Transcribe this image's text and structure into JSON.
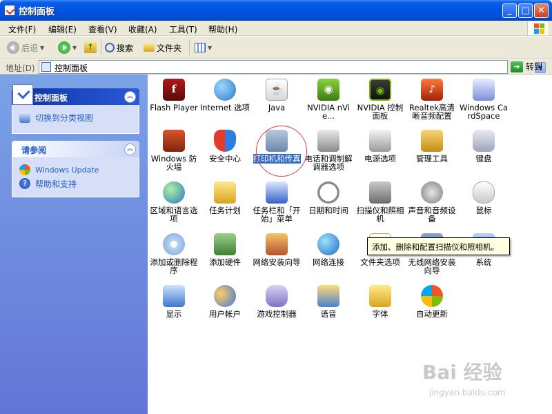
{
  "window": {
    "title": "控制面板"
  },
  "menu": [
    "文件(F)",
    "编辑(E)",
    "查看(V)",
    "收藏(A)",
    "工具(T)",
    "帮助(H)"
  ],
  "toolbar": {
    "back": "后退",
    "search": "搜索",
    "folders": "文件夹"
  },
  "address": {
    "label": "地址(D)",
    "value": "控制面板",
    "go": "转到"
  },
  "sidebar": {
    "cp_panel_title": "控制面板",
    "switch_view": "切换到分类视图",
    "see_also_title": "请参阅",
    "windows_update": "Windows Update",
    "help_support": "帮助和支持"
  },
  "items": [
    {
      "label": "Flash Player",
      "icon": "flash-icon"
    },
    {
      "label": "Internet 选项",
      "icon": "internet-options-icon"
    },
    {
      "label": "Java",
      "icon": "java-icon"
    },
    {
      "label": "NVIDIA nVie...",
      "icon": "nvidia-nview-icon"
    },
    {
      "label": "NVIDIA 控制面板",
      "icon": "nvidia-control-panel-icon"
    },
    {
      "label": "Realtek高清晰音频配置",
      "icon": "realtek-audio-icon"
    },
    {
      "label": "Windows CardSpace",
      "icon": "cardspace-icon"
    },
    {
      "label": "Windows 防火墙",
      "icon": "firewall-icon"
    },
    {
      "label": "安全中心",
      "icon": "security-center-icon"
    },
    {
      "label": "打印机和传真",
      "icon": "printer-fax-icon"
    },
    {
      "label": "电话和调制解调器选项",
      "icon": "phone-modem-icon"
    },
    {
      "label": "电源选项",
      "icon": "power-options-icon"
    },
    {
      "label": "管理工具",
      "icon": "admin-tools-icon"
    },
    {
      "label": "键盘",
      "icon": "keyboard-icon"
    },
    {
      "label": "区域和语言选项",
      "icon": "region-language-icon"
    },
    {
      "label": "任务计划",
      "icon": "scheduled-tasks-icon"
    },
    {
      "label": "任务栏和「开始」菜单",
      "icon": "taskbar-start-icon"
    },
    {
      "label": "日期和时间",
      "icon": "date-time-icon"
    },
    {
      "label": "扫描仪和照相机",
      "icon": "scanner-camera-icon"
    },
    {
      "label": "声音和音频设备",
      "icon": "sound-audio-icon"
    },
    {
      "label": "鼠标",
      "icon": "mouse-icon"
    },
    {
      "label": "添加或删除程序",
      "icon": "add-remove-programs-icon"
    },
    {
      "label": "添加硬件",
      "icon": "add-hardware-icon"
    },
    {
      "label": "网络安装向导",
      "icon": "network-setup-icon"
    },
    {
      "label": "网络连接",
      "icon": "network-connections-icon"
    },
    {
      "label": "文件夹选项",
      "icon": "folder-options-icon"
    },
    {
      "label": "无线网络安装向导",
      "icon": "wireless-setup-icon"
    },
    {
      "label": "系统",
      "icon": "system-icon"
    },
    {
      "label": "显示",
      "icon": "display-icon"
    },
    {
      "label": "用户帐户",
      "icon": "user-accounts-icon"
    },
    {
      "label": "游戏控制器",
      "icon": "game-controllers-icon"
    },
    {
      "label": "语音",
      "icon": "speech-icon"
    },
    {
      "label": "字体",
      "icon": "fonts-icon"
    },
    {
      "label": "自动更新",
      "icon": "automatic-updates-icon"
    }
  ],
  "tooltip": "添加、删除和配置扫描仪和照相机。",
  "watermark": {
    "brand": "Bai 经验",
    "url": "jingyan.baidu.com"
  }
}
